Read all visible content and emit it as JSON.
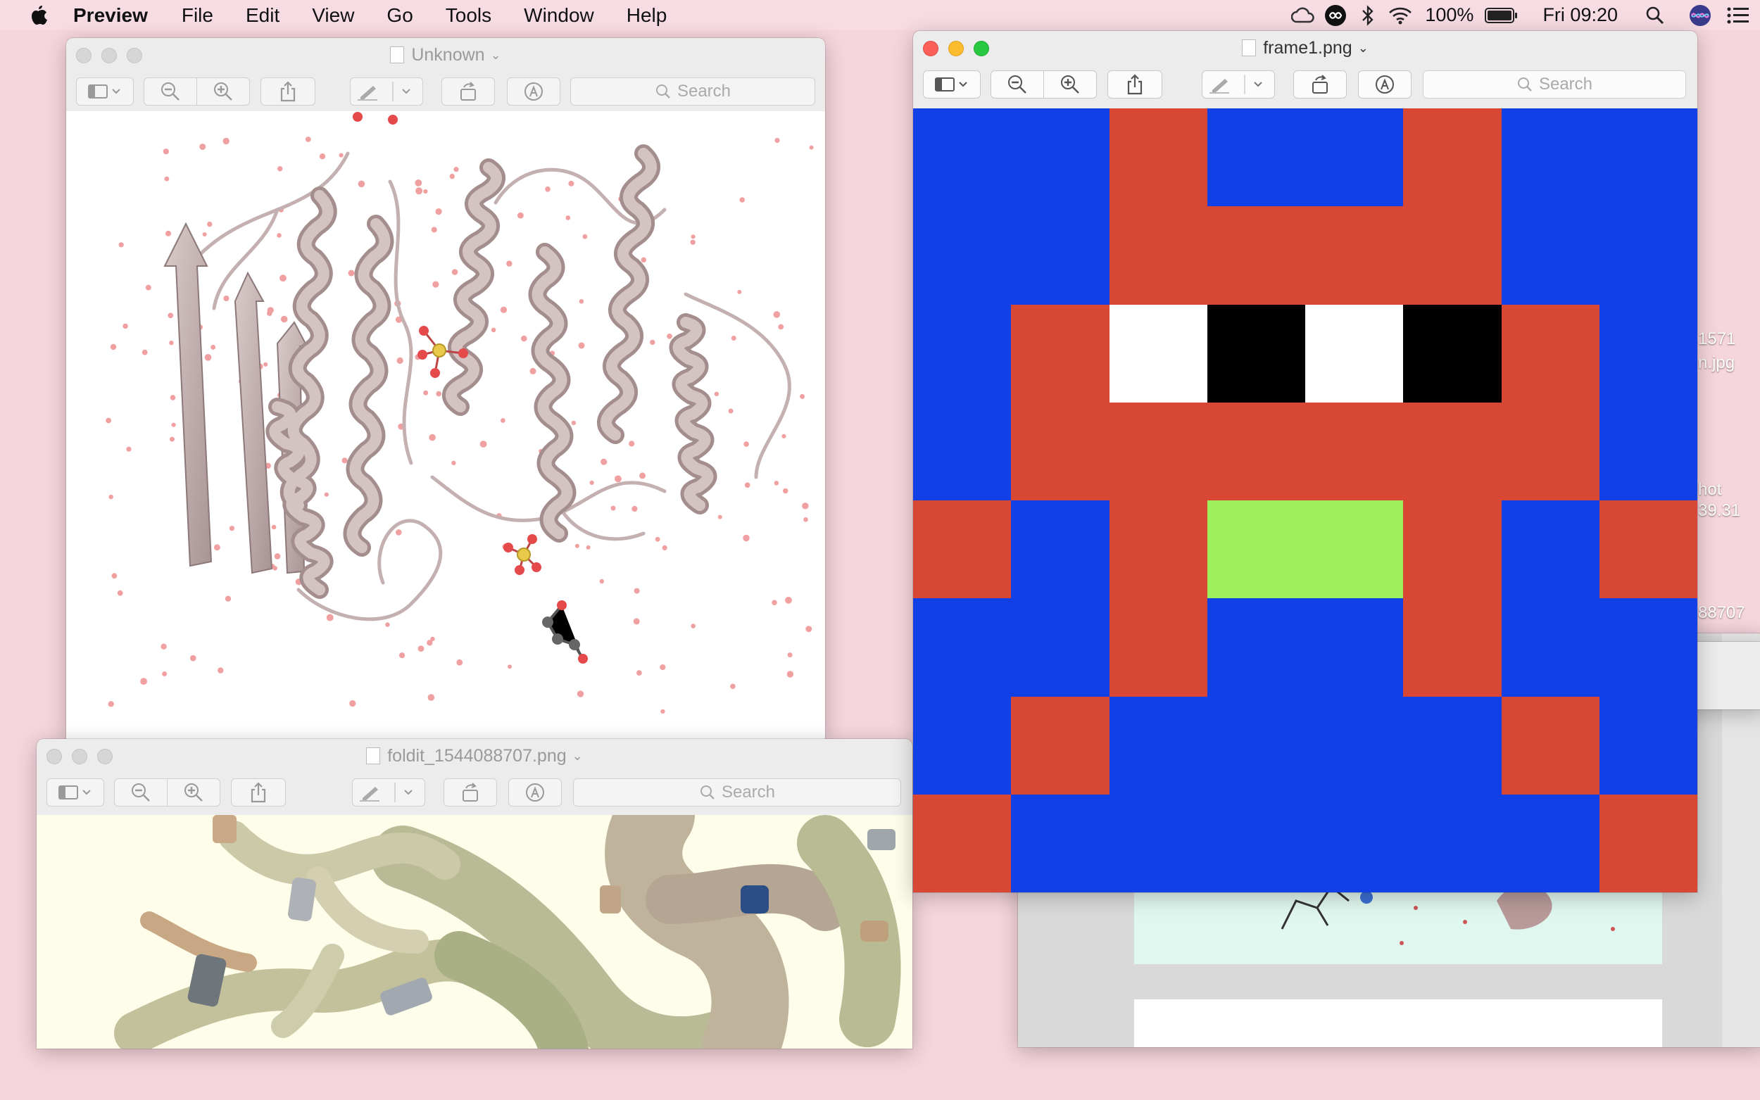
{
  "menubar": {
    "app_name": "Preview",
    "items": [
      "File",
      "Edit",
      "View",
      "Go",
      "Tools",
      "Window",
      "Help"
    ],
    "battery": "100%",
    "clock": "Fri 09:20"
  },
  "windows": {
    "unknown": {
      "title": "Unknown",
      "search_placeholder": "Search"
    },
    "foldit": {
      "title": "foldit_1544088707.png",
      "search_placeholder": "Search"
    },
    "frame1": {
      "title": "frame1.png",
      "search_placeholder": "Search"
    }
  },
  "desktop_labels": {
    "a1": "1571",
    "a2": "n.jpg",
    "b1": "hot",
    "b2": "39.31",
    "c1": "88707"
  },
  "pixel_art": {
    "palette": {
      "B": "#1040e6",
      "R": "#d84634",
      "W": "#ffffff",
      "K": "#000000",
      "G": "#9df05c"
    },
    "rows": [
      "BBRBBRBB",
      "BBRRRRBB",
      "BRWKWKRB",
      "BRRRRRRB",
      "RBRGGRBR",
      "BBRBBRBB",
      "BRBBBBRB",
      "RBBBBBBR"
    ]
  },
  "colors": {
    "desktop": "#f6d6dd",
    "protein": "#c2b0b0",
    "water": "#e88b8b"
  }
}
